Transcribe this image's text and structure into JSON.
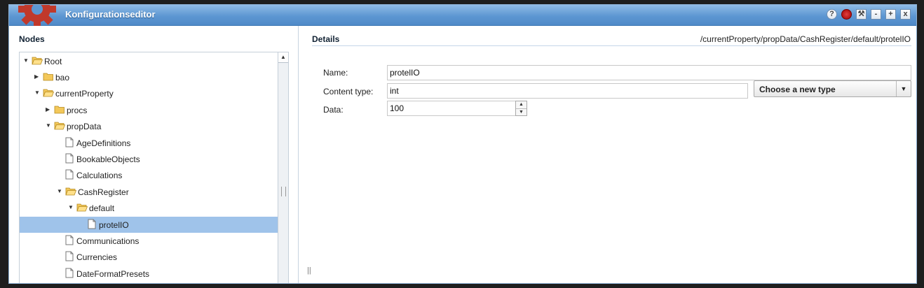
{
  "window": {
    "title": "Konfigurationseditor"
  },
  "titlebar_buttons": [
    {
      "name": "help-icon",
      "glyph": "?"
    },
    {
      "name": "bug-icon",
      "glyph": "●"
    },
    {
      "name": "wrench-icon",
      "glyph": "🔧"
    },
    {
      "name": "minimize-icon",
      "glyph": "-"
    },
    {
      "name": "maximize-icon",
      "glyph": "+"
    },
    {
      "name": "close-icon",
      "glyph": "x"
    }
  ],
  "nodes": {
    "title": "Nodes",
    "items": [
      {
        "label": "Root",
        "depth": 0,
        "type": "folder",
        "state": "expanded",
        "selected": false
      },
      {
        "label": "bao",
        "depth": 1,
        "type": "folder",
        "state": "collapsed",
        "selected": false
      },
      {
        "label": "currentProperty",
        "depth": 1,
        "type": "folder",
        "state": "expanded",
        "selected": false
      },
      {
        "label": "procs",
        "depth": 2,
        "type": "folder",
        "state": "collapsed",
        "selected": false
      },
      {
        "label": "propData",
        "depth": 2,
        "type": "folder",
        "state": "expanded",
        "selected": false
      },
      {
        "label": "AgeDefinitions",
        "depth": 3,
        "type": "file",
        "state": "leaf",
        "selected": false
      },
      {
        "label": "BookableObjects",
        "depth": 3,
        "type": "file",
        "state": "leaf",
        "selected": false
      },
      {
        "label": "Calculations",
        "depth": 3,
        "type": "file",
        "state": "leaf",
        "selected": false
      },
      {
        "label": "CashRegister",
        "depth": 3,
        "type": "folder",
        "state": "expanded",
        "selected": false
      },
      {
        "label": "default",
        "depth": 4,
        "type": "folder",
        "state": "expanded",
        "selected": false
      },
      {
        "label": "protelIO",
        "depth": 5,
        "type": "file",
        "state": "leaf",
        "selected": true
      },
      {
        "label": "Communications",
        "depth": 3,
        "type": "file",
        "state": "leaf",
        "selected": false
      },
      {
        "label": "Currencies",
        "depth": 3,
        "type": "file",
        "state": "leaf",
        "selected": false
      },
      {
        "label": "DateFormatPresets",
        "depth": 3,
        "type": "file",
        "state": "leaf",
        "selected": false
      }
    ]
  },
  "details": {
    "title": "Details",
    "path": "/currentProperty/propData/CashRegister/default/protelIO",
    "name_label": "Name:",
    "name_value": "protelIO",
    "content_type_label": "Content type:",
    "content_type_value": "int",
    "type_select": "Choose a new type",
    "data_label": "Data:",
    "data_value": "100"
  },
  "colors": {
    "titlebar": "#5d97d2",
    "selected_row": "#9fc3ea",
    "folder": "#f3c85a"
  }
}
